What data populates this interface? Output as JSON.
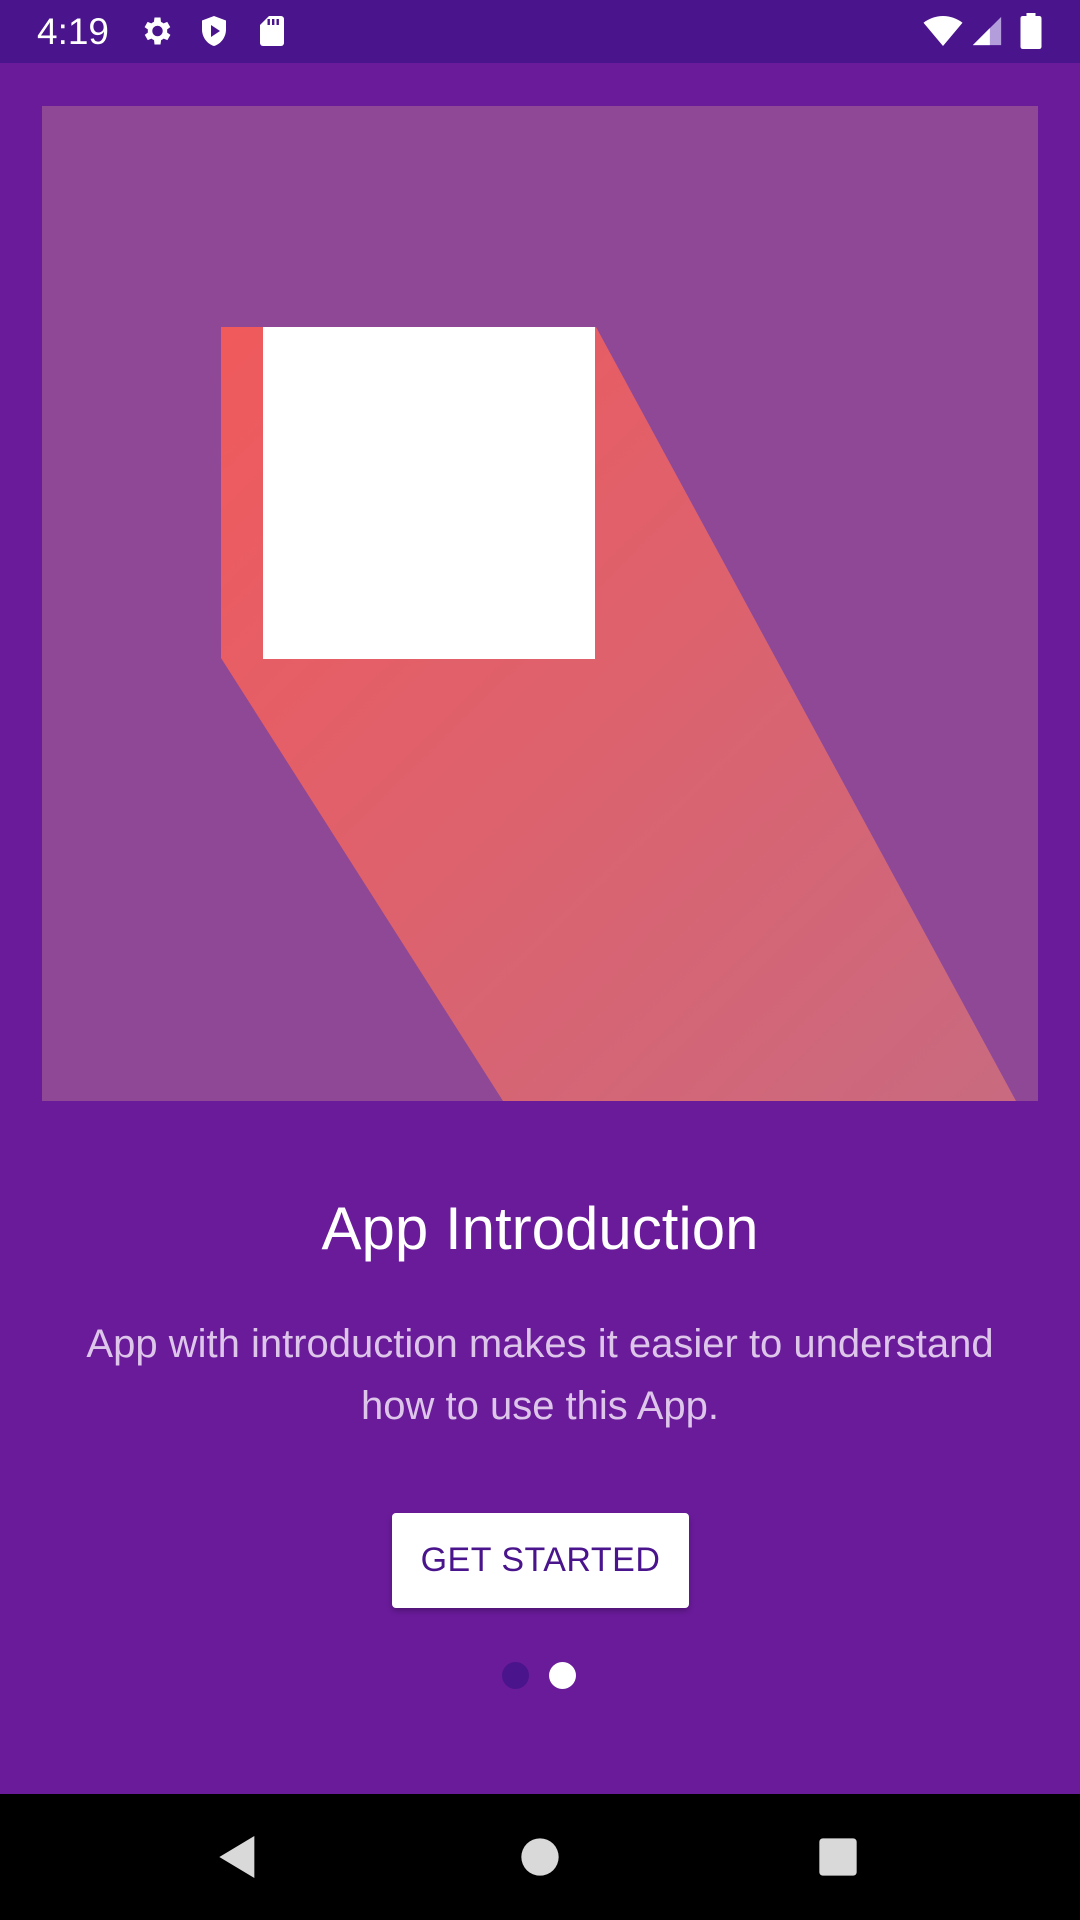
{
  "status_bar": {
    "time": "4:19",
    "left_icons": [
      "gear-icon",
      "shield-play-icon",
      "sd-card-icon"
    ],
    "right_icons": [
      "wifi-icon",
      "signal-icon",
      "battery-icon"
    ]
  },
  "intro": {
    "title": "App Introduction",
    "description": "App with introduction makes it easier to understand how to use this App.",
    "cta_label": "GET STARTED"
  },
  "pager": {
    "page_count": 2,
    "current_page": 2
  },
  "nav_bar": {
    "buttons": [
      "back-icon",
      "home-icon",
      "recents-icon"
    ]
  },
  "colors": {
    "background": "#6a1b9a",
    "status_bar": "#4a148c",
    "hero_background": "#8e4896",
    "hero_shadow": "#e85d66",
    "cta_text": "#4a148c",
    "dot_inactive": "#4a148c",
    "dot_active": "#ffffff"
  }
}
